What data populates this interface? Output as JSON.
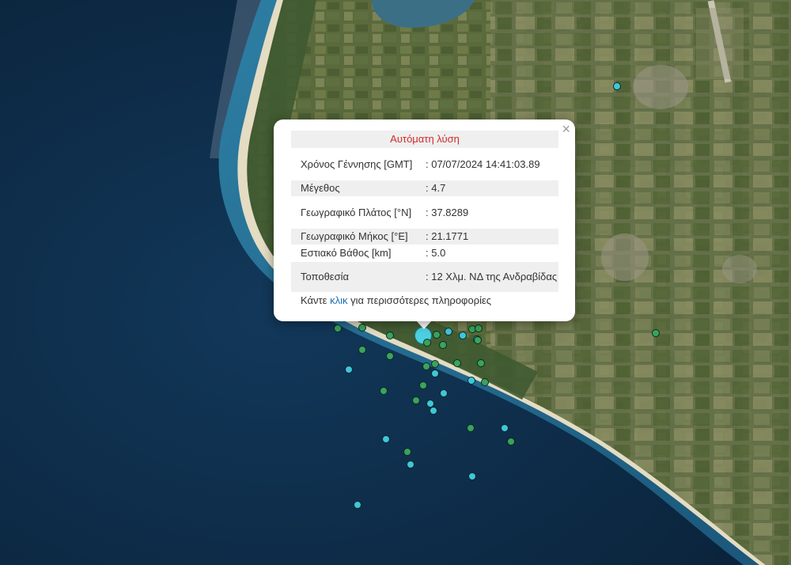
{
  "map": {
    "colors": {
      "sea_deep": "#0d2a45",
      "sea_shallow": "#2e7fa3",
      "land": "#5e6a3f",
      "beach": "#e6e0cc",
      "event_green": "#3aa35c",
      "event_cyan": "#3fc6dc"
    }
  },
  "popup": {
    "title": "Αυτόματη λύση",
    "close_label": "×",
    "rows": [
      {
        "label": "Χρόνος Γέννησης [GMT]",
        "value": ": 07/07/2024 14:41:03.89"
      },
      {
        "label": "Μέγεθος",
        "value": ": 4.7"
      },
      {
        "label": "Γεωγραφικό Πλάτος [°N]",
        "value": ": 37.8289"
      },
      {
        "label": "Γεωγραφικό Μήκος [°E]",
        "value": ": 21.1771"
      },
      {
        "label": "Εστιακό Βάθος [km]",
        "value": ": 5.0"
      },
      {
        "label": "Τοποθεσία",
        "value": ": 12 Χλμ. ΝΔ της Ανδραβίδας"
      }
    ],
    "more_prefix": "Κάντε ",
    "more_link": "κλικ",
    "more_suffix": " για περισσότερες πληροφορίες"
  }
}
